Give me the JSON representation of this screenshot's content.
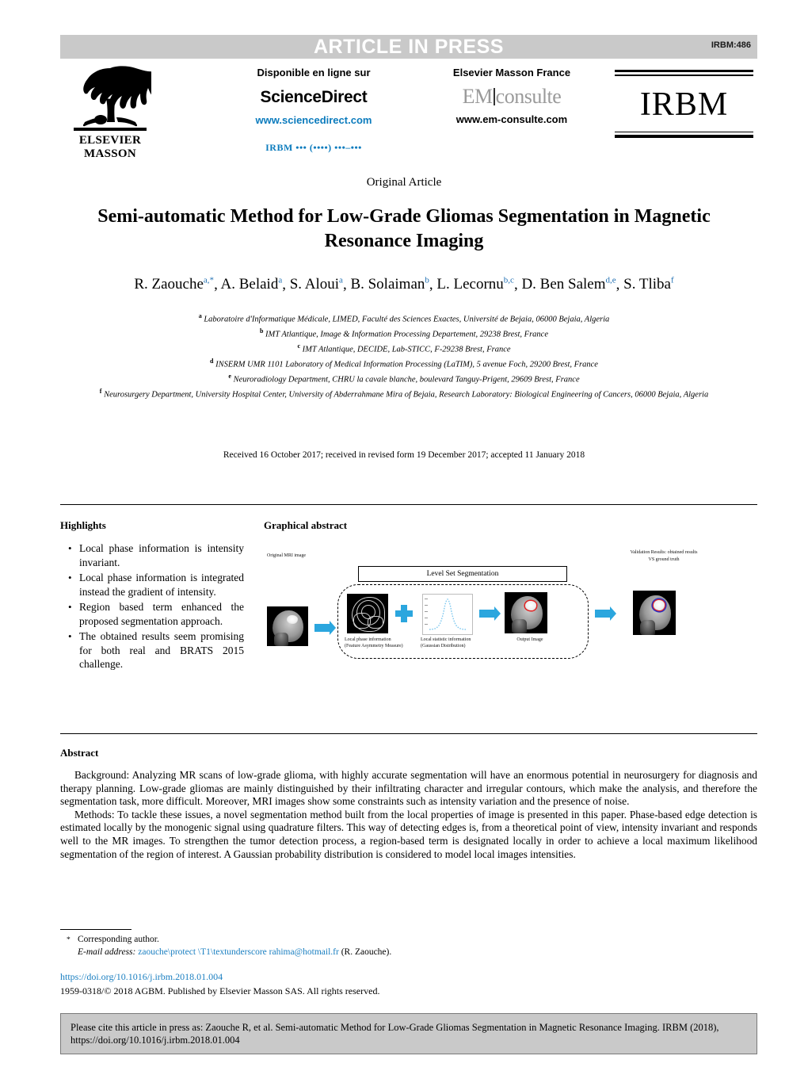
{
  "banner": {
    "title": "ARTICLE IN PRESS",
    "journal_code": "IRBM:486"
  },
  "masthead": {
    "elsevier": {
      "logo_icon": "elsevier-tree-logo",
      "line1": "ELSEVIER",
      "line2": "MASSON"
    },
    "sciencedirect": {
      "available_online": "Disponible en ligne sur",
      "logo": "ScienceDirect",
      "url": "www.sciencedirect.com",
      "volume_line": "IRBM ••• (••••) •••–•••"
    },
    "emconsulte": {
      "publisher": "Elsevier Masson France",
      "logo_left": "EM",
      "logo_right": "consulte",
      "url": "www.em-consulte.com"
    },
    "journal_logo": "IRBM"
  },
  "article": {
    "type": "Original Article",
    "title": "Semi-automatic Method for Low-Grade Gliomas Segmentation in Magnetic Resonance Imaging",
    "authors": [
      {
        "name": "R. Zaouche",
        "marks": "a,*"
      },
      {
        "name": "A. Belaid",
        "marks": "a"
      },
      {
        "name": "S. Aloui",
        "marks": "a"
      },
      {
        "name": "B. Solaiman",
        "marks": "b"
      },
      {
        "name": "L. Lecornu",
        "marks": "b,c"
      },
      {
        "name": "D. Ben Salem",
        "marks": "d,e"
      },
      {
        "name": "S. Tliba",
        "marks": "f"
      }
    ],
    "affiliations": [
      {
        "mark": "a",
        "text": "Laboratoire d'Informatique Médicale, LIMED, Faculté des Sciences Exactes, Université de Bejaia, 06000 Bejaia, Algeria"
      },
      {
        "mark": "b",
        "text": "IMT Atlantique, Image & Information Processing Departement, 29238 Brest, France"
      },
      {
        "mark": "c",
        "text": "IMT Atlantique, DECIDE, Lab-STICC, F-29238 Brest, France"
      },
      {
        "mark": "d",
        "text": "INSERM UMR 1101 Laboratory of Medical Information Processing (LaTIM), 5 avenue Foch, 29200 Brest, France"
      },
      {
        "mark": "e",
        "text": "Neuroradiology Department, CHRU la cavale blanche, boulevard Tanguy-Prigent, 29609 Brest, France"
      },
      {
        "mark": "f",
        "text": "Neurosurgery Department, University Hospital Center, University of Abderrahmane Mira of Bejaia, Research Laboratory: Biological Engineering of Cancers, 06000 Bejaia, Algeria"
      }
    ],
    "dates": "Received 16 October 2017; received in revised form 19 December 2017; accepted 11 January 2018"
  },
  "highlights": {
    "heading": "Highlights",
    "items": [
      "Local phase information is intensity invariant.",
      "Local phase information is integrated instead the gradient of intensity.",
      "Region based term enhanced the proposed segmentation approach.",
      "The obtained results seem promising for both real and BRATS 2015 challenge."
    ]
  },
  "graphical_abstract": {
    "heading": "Graphical abstract",
    "input_label": "Original MRI image",
    "process_box_label": "Level Set Segmentation",
    "phase_caption_line1": "Local phase information",
    "phase_caption_line2": "(Feature Asymmetry Measure)",
    "stat_caption_line1": "Local statistic information",
    "stat_caption_line2": "(Gaussian Distribution)",
    "output_caption": "Output Image",
    "validation_line1": "Validation Results: obtained results",
    "validation_line2": "VS ground truth",
    "arrow_color": "#2ba6de",
    "tumor_contour_color": "#e41f1f",
    "ground_truth_contour_color": "#2433c8"
  },
  "abstract": {
    "heading": "Abstract",
    "paragraphs": [
      "Background: Analyzing MR scans of low-grade glioma, with highly accurate segmentation will have an enormous potential in neurosurgery for diagnosis and therapy planning. Low-grade gliomas are mainly distinguished by their infiltrating character and irregular contours, which make the analysis, and therefore the segmentation task, more difficult. Moreover, MRI images show some constraints such as intensity variation and the presence of noise.",
      "Methods: To tackle these issues, a novel segmentation method built from the local properties of image is presented in this paper. Phase-based edge detection is estimated locally by the monogenic signal using quadrature filters. This way of detecting edges is, from a theoretical point of view, intensity invariant and responds well to the MR images. To strengthen the tumor detection process, a region-based term is designated locally in order to achieve a local maximum likelihood segmentation of the region of interest. A Gaussian probability distribution is considered to model local images intensities."
    ]
  },
  "footnotes": {
    "corresponding_marker": "*",
    "corresponding_text": "Corresponding author.",
    "email_label": "E-mail address:",
    "email_value": "zaouche\\protect \\T1\\textunderscore rahima@hotmail.fr",
    "email_attribution": "(R. Zaouche).",
    "doi": "https://doi.org/10.1016/j.irbm.2018.01.004",
    "copyright": "1959-0318/© 2018 AGBM. Published by Elsevier Masson SAS. All rights reserved."
  },
  "citation_box": {
    "text": "Please cite this article in press as: Zaouche R, et al. Semi-automatic Method for Low-Grade Gliomas Segmentation in Magnetic Resonance Imaging. IRBM (2018), https://doi.org/10.1016/j.irbm.2018.01.004"
  }
}
